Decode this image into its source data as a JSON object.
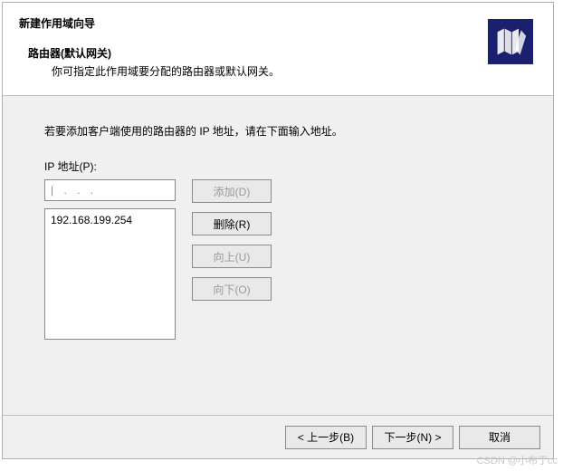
{
  "header": {
    "dialog_title": "新建作用域向导",
    "section_title": "路由器(默认网关)",
    "section_sub": "你可指定此作用域要分配的路由器或默认网关。"
  },
  "body": {
    "instruction": "若要添加客户端使用的路由器的 IP 地址，请在下面输入地址。",
    "ip_label": "IP 地址(P):",
    "ip_input_placeholder": "| .   .   .",
    "list_items": [
      "192.168.199.254"
    ]
  },
  "buttons": {
    "add": "添加(D)",
    "remove": "删除(R)",
    "up": "向上(U)",
    "down": "向下(O)",
    "back": "< 上一步(B)",
    "next": "下一步(N) >",
    "cancel": "取消"
  },
  "watermark": "CSDN @小布丁cc"
}
